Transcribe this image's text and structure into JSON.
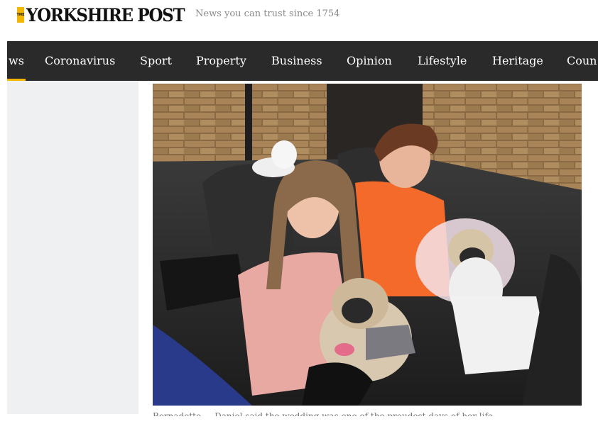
{
  "header": {
    "logo_small": "THE",
    "logo_text": "YORKSHIRE POST",
    "tagline": "News you can trust since 1754"
  },
  "nav": {
    "items": [
      {
        "label": "ws"
      },
      {
        "label": "Coronavirus"
      },
      {
        "label": "Sport"
      },
      {
        "label": "Property"
      },
      {
        "label": "Business"
      },
      {
        "label": "Opinion"
      },
      {
        "label": "Lifestyle"
      },
      {
        "label": "Heritage"
      },
      {
        "label": "Coun"
      }
    ]
  },
  "article": {
    "caption": "Bernadette ... Daniel said the wedding was one of the proudest days of her life"
  },
  "colors": {
    "accent": "#f2b705",
    "nav_bg": "#2a2a2a",
    "sidebar_bg": "#eef0f1"
  }
}
